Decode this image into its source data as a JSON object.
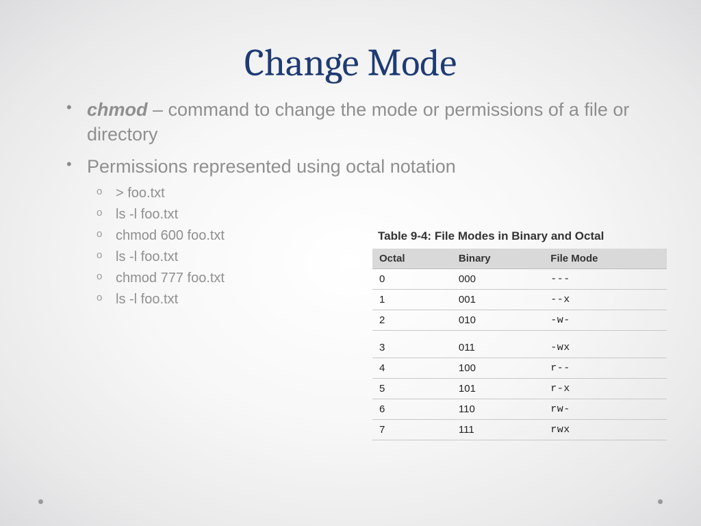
{
  "title": "Change Mode",
  "bullets": {
    "b1_cmd": "chmod",
    "b1_rest": " – command to change the mode or permissions of a file or directory",
    "b2": "Permissions represented using octal notation"
  },
  "sublist": [
    "> foo.txt",
    "ls -l foo.txt",
    "chmod 600 foo.txt",
    "ls -l foo.txt",
    "chmod 777 foo.txt",
    "ls -l foo.txt"
  ],
  "table": {
    "caption": "Table 9-4: File Modes in Binary and Octal",
    "headers": {
      "c1": "Octal",
      "c2": "Binary",
      "c3": "File Mode"
    },
    "rows_top": [
      {
        "octal": "0",
        "binary": "000",
        "mode": "---"
      },
      {
        "octal": "1",
        "binary": "001",
        "mode": "--x"
      },
      {
        "octal": "2",
        "binary": "010",
        "mode": "-w-"
      }
    ],
    "rows_bottom": [
      {
        "octal": "3",
        "binary": "011",
        "mode": "-wx"
      },
      {
        "octal": "4",
        "binary": "100",
        "mode": "r--"
      },
      {
        "octal": "5",
        "binary": "101",
        "mode": "r-x"
      },
      {
        "octal": "6",
        "binary": "110",
        "mode": "rw-"
      },
      {
        "octal": "7",
        "binary": "111",
        "mode": "rwx"
      }
    ]
  },
  "chart_data": {
    "type": "table",
    "title": "Table 9-4: File Modes in Binary and Octal",
    "columns": [
      "Octal",
      "Binary",
      "File Mode"
    ],
    "rows": [
      [
        "0",
        "000",
        "---"
      ],
      [
        "1",
        "001",
        "--x"
      ],
      [
        "2",
        "010",
        "-w-"
      ],
      [
        "3",
        "011",
        "-wx"
      ],
      [
        "4",
        "100",
        "r--"
      ],
      [
        "5",
        "101",
        "r-x"
      ],
      [
        "6",
        "110",
        "rw-"
      ],
      [
        "7",
        "111",
        "rwx"
      ]
    ]
  }
}
